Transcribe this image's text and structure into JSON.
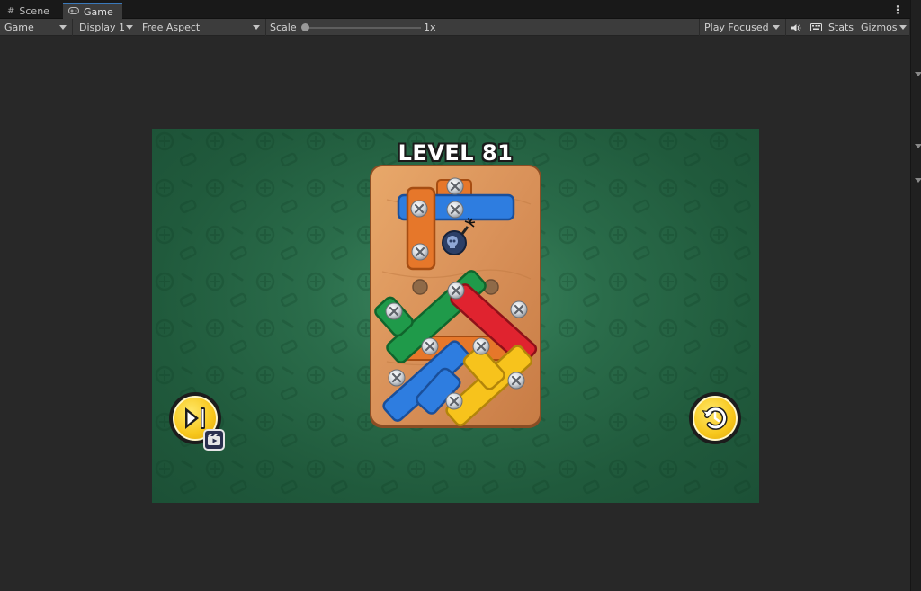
{
  "tabs": [
    {
      "label": "Scene",
      "icon": "grid-icon",
      "active": false
    },
    {
      "label": "Game",
      "icon": "gamepad-icon",
      "active": true
    }
  ],
  "toolbar": {
    "game_select": "Game",
    "display_select": "Display 1",
    "aspect_select": "Free Aspect",
    "scale_label": "Scale",
    "scale_value": "1x",
    "play_mode_select": "Play Focused",
    "audio_icon": "speaker-icon",
    "keyboard_icon": "keyboard-icon",
    "stats_label": "Stats",
    "gizmos_label": "Gizmos"
  },
  "game": {
    "level_title": "LEVEL 81",
    "skip_icon": "skip-forward-icon",
    "ad_icon": "video-ad-icon",
    "restart_icon": "restart-icon",
    "bomb_icon": "skull-bomb-icon",
    "colors": {
      "background": "#2a6c4a",
      "board": "#d9955a",
      "plank_orange": "#e6772a",
      "plank_blue": "#2e7de0",
      "plank_green": "#1f9a4a",
      "plank_red": "#e0232f",
      "plank_yellow": "#f7c31c",
      "button_yellow": "#f7c71c"
    }
  }
}
